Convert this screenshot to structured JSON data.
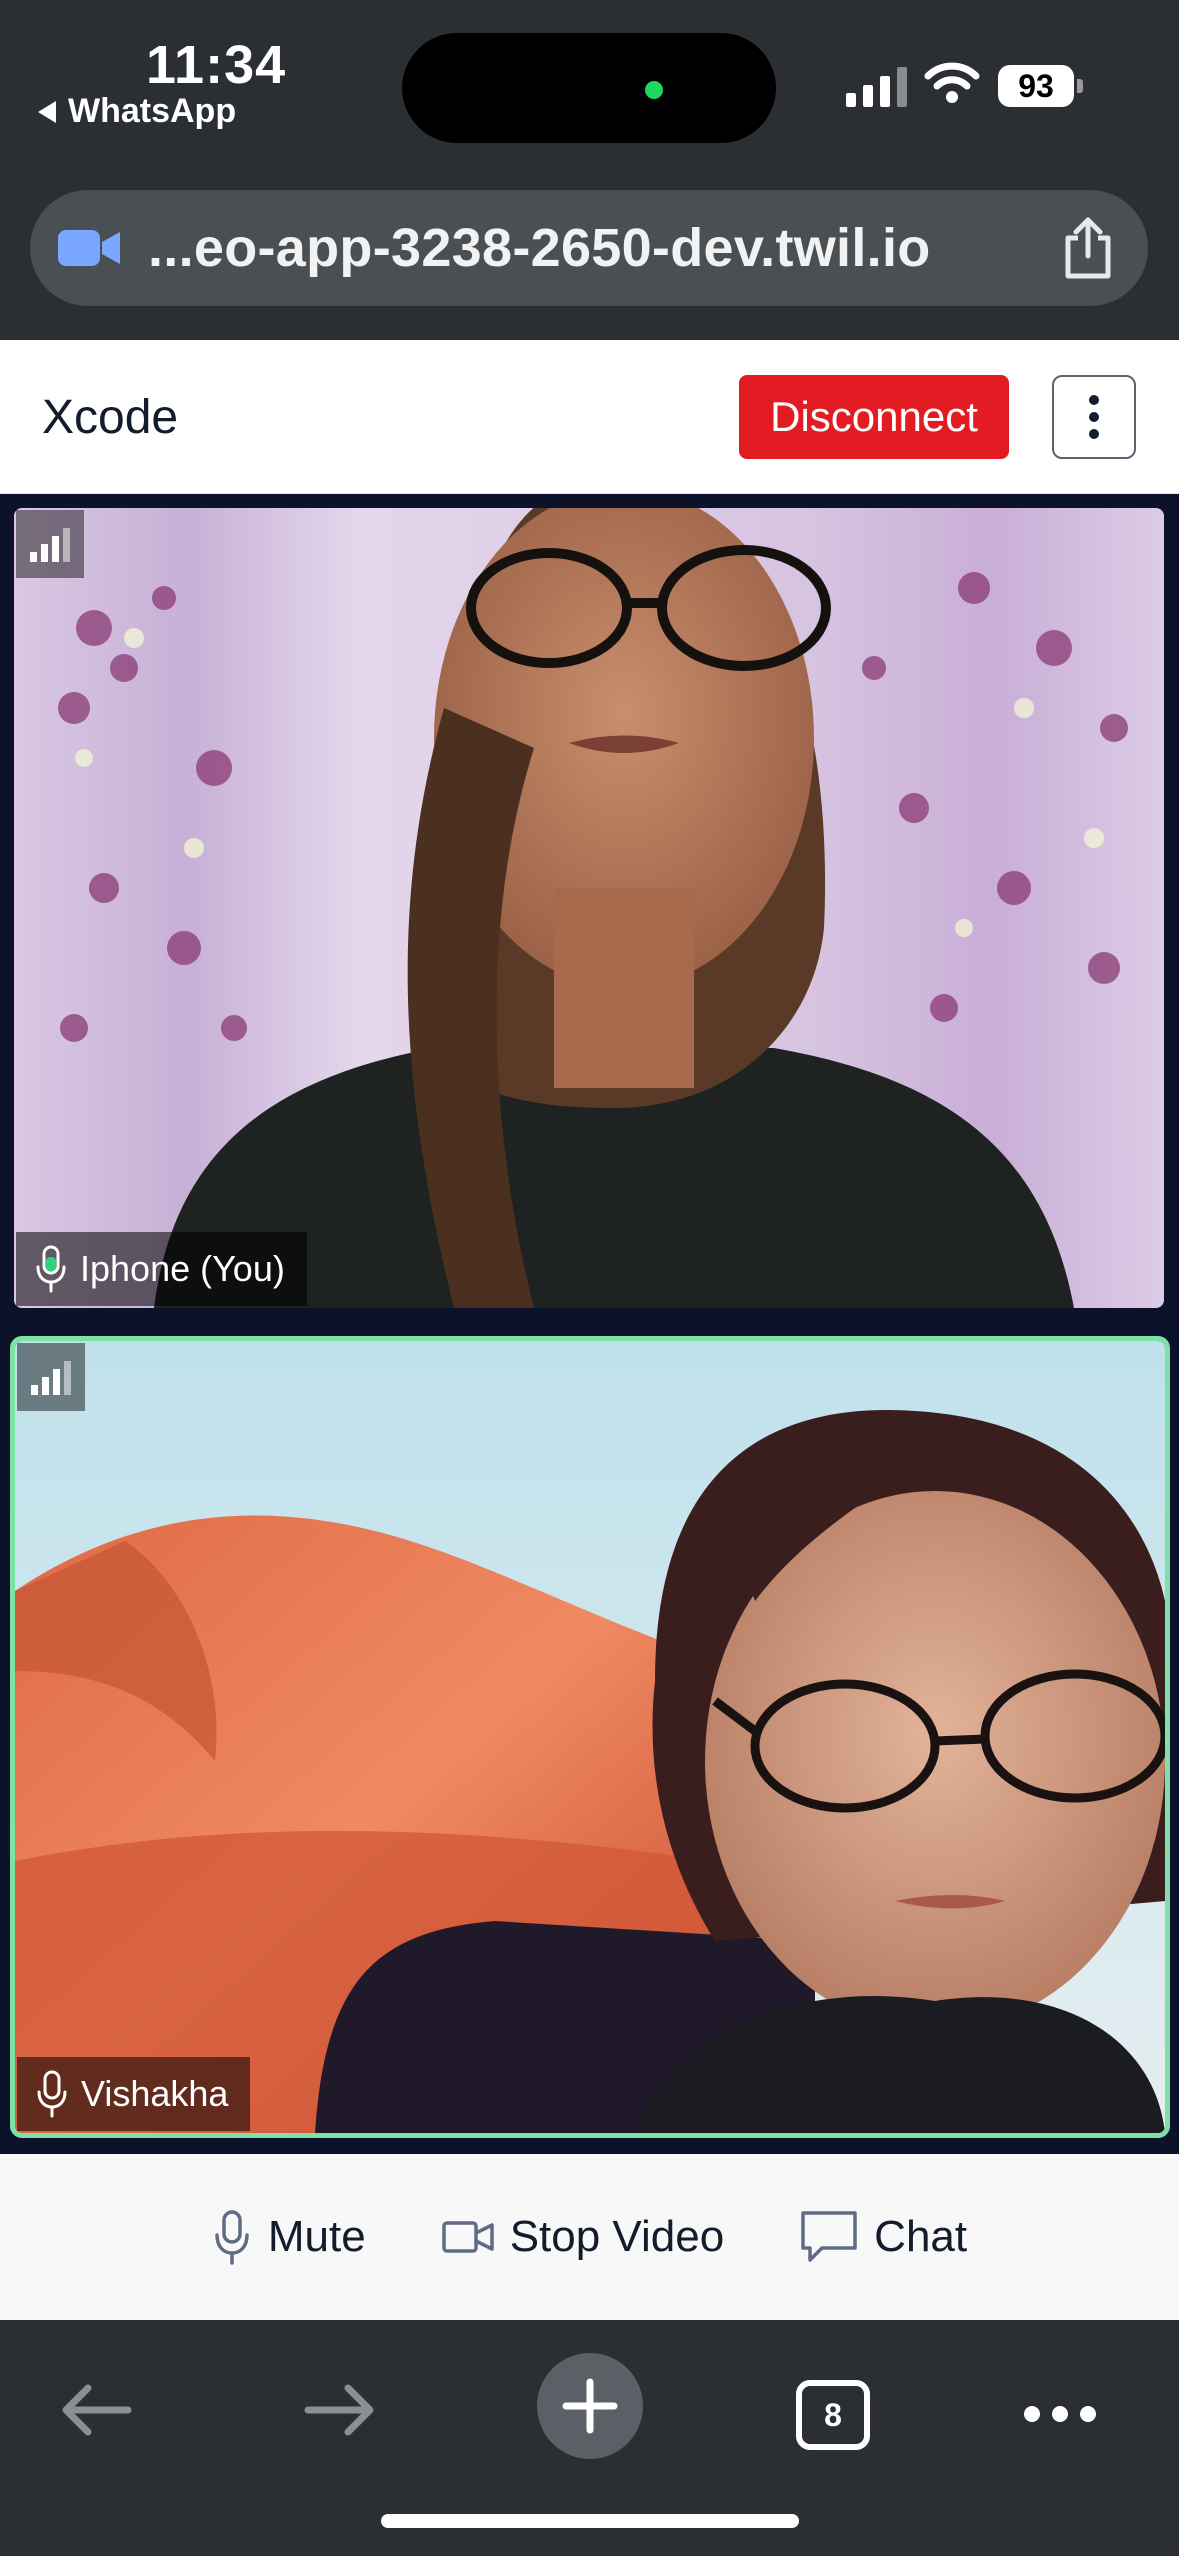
{
  "status_bar": {
    "time": "11:34",
    "back_app": "WhatsApp",
    "battery": "93",
    "recording_dot_color": "#1ed760"
  },
  "browser": {
    "url": "...eo-app-3238-2650-dev.twil.io",
    "site_icon": "video-camera-icon",
    "share_icon": "share-icon",
    "tabs_count": "8"
  },
  "header": {
    "room_name": "Xcode",
    "disconnect_label": "Disconnect",
    "disconnect_color": "#e31b23"
  },
  "participants": [
    {
      "name": "Iphone (You)",
      "mic_icon": "microphone-icon",
      "network_icon": "network-quality-icon"
    },
    {
      "name": "Vishakha",
      "mic_icon": "microphone-icon",
      "network_icon": "network-quality-icon",
      "active_speaker_color": "#7ee2a8"
    }
  ],
  "menu": {
    "mute_label": "Mute",
    "stop_video_label": "Stop Video",
    "chat_label": "Chat"
  }
}
